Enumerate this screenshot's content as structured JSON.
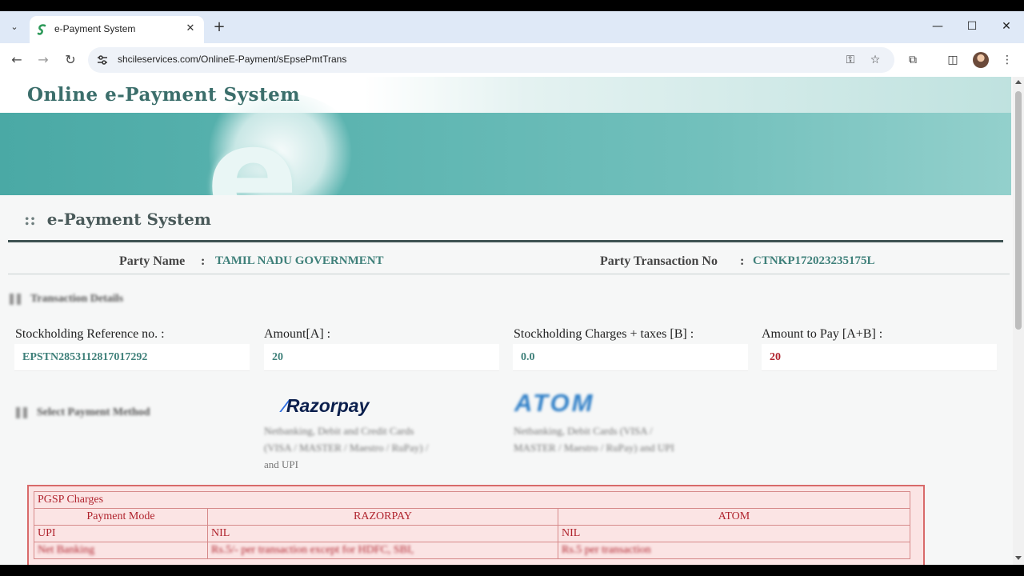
{
  "browser": {
    "tab_title": "e-Payment System",
    "url": "shcileservices.com/OnlineE-Payment/sEpsePmtTrans",
    "icons": {
      "tab_list": "chevron-down-icon",
      "new_tab": "plus-icon",
      "minimize": "minimize-icon",
      "maximize": "maximize-icon",
      "close": "close-icon",
      "back": "back-arrow-icon",
      "forward": "forward-arrow-icon",
      "reload": "reload-icon",
      "site_info": "tune-icon",
      "password": "key-icon",
      "bookmark": "star-icon",
      "extensions": "puzzle-icon",
      "side_panel": "side-panel-icon",
      "menu": "kebab-menu-icon"
    }
  },
  "banner": {
    "title": "Online e-Payment System",
    "letter": "e"
  },
  "page": {
    "section_title": "e-Payment System",
    "section_marker": "::"
  },
  "party": {
    "name_label": "Party Name",
    "separator": ":",
    "name_value": "TAMIL NADU GOVERNMENT",
    "txn_label": "Party Transaction No",
    "txn_value": "CTNKP172023235175L"
  },
  "transaction": {
    "heading": "Transaction Details",
    "fields": [
      {
        "label": "Stockholding Reference no. :",
        "value": "EPSTN2853112817017292"
      },
      {
        "label": "Amount[A] :",
        "value": "20"
      },
      {
        "label": "Stockholding Charges + taxes [B] :",
        "value": "0.0"
      },
      {
        "label": "Amount to Pay [A+B] :",
        "value": "20"
      }
    ]
  },
  "payment": {
    "heading": "Select Payment Method",
    "razorpay": {
      "logo_text": "Razorpay",
      "desc_line1": "Netbanking, Debit and Credit Cards",
      "desc_line2": "(VISA / MASTER / Maestro / RuPay) /",
      "desc_line3": "and UPI"
    },
    "atom": {
      "logo_text": "ATOM",
      "desc_line1": "Netbanking, Debit Cards (VISA /",
      "desc_line2": "MASTER / Maestro / RuPay) and UPI"
    }
  },
  "pgsp": {
    "title": "PGSP Charges",
    "headers": [
      "Payment Mode",
      "RAZORPAY",
      "ATOM"
    ],
    "rows": [
      [
        "UPI",
        "NIL",
        "NIL"
      ],
      [
        "Net Banking",
        "Rs.5/- per transaction except for HDFC, SBI,",
        "Rs.5 per transaction"
      ]
    ]
  },
  "colors": {
    "brand_teal": "#3f807a",
    "banner_band": "#5fb6b2",
    "amount_red": "#b0242e",
    "pgsp_border": "#d86a6a",
    "pgsp_bg": "#fbe4e4"
  }
}
